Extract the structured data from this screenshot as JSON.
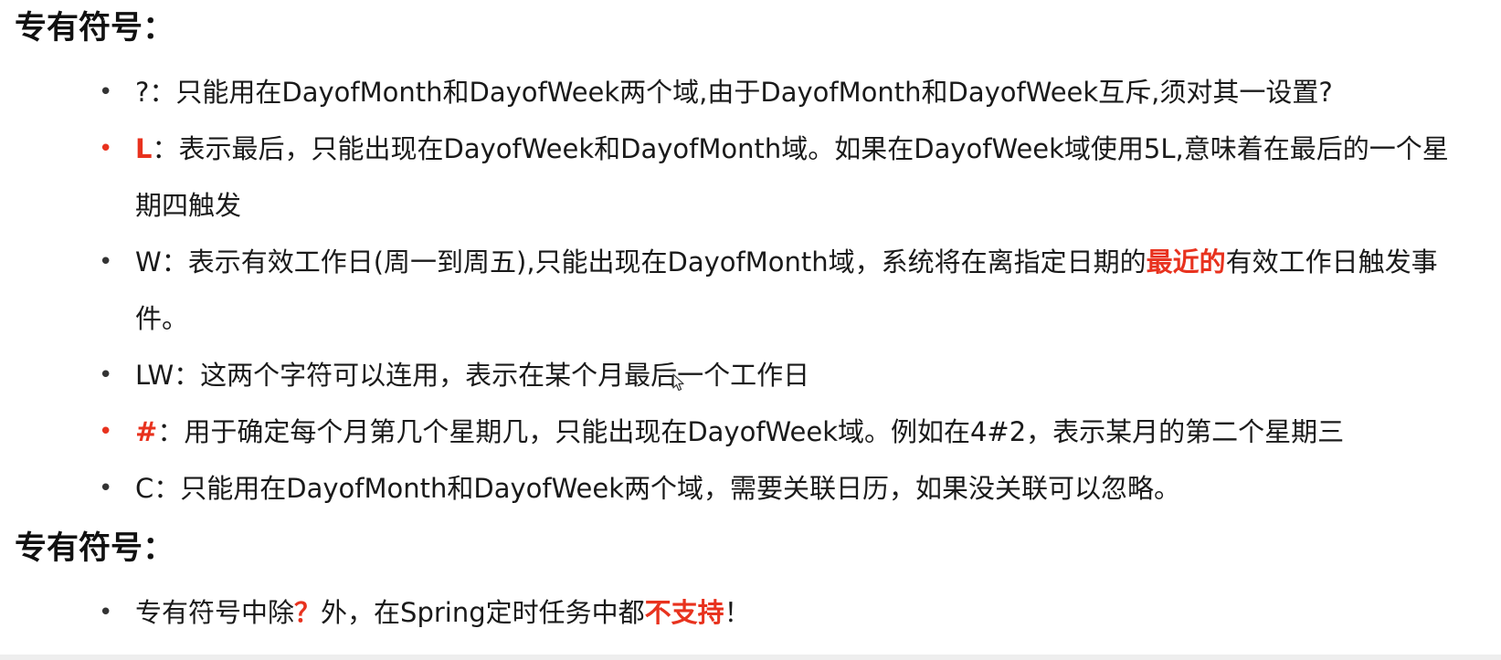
{
  "section1": {
    "heading": "专有符号："
  },
  "items": [
    {
      "key": "?",
      "text": "：只能用在DayofMonth和DayofWeek两个域,由于DayofMonth和DayofWeek互斥,须对其一设置?"
    },
    {
      "key": "L",
      "text": "：表示最后，只能出现在DayofWeek和DayofMonth域。如果在DayofWeek域使用5L,意味着在最后的一个星期四触发"
    },
    {
      "key": "W",
      "text_before": "：表示有效工作日(周一到周五),只能出现在DayofMonth域，系统将在离指定日期的",
      "highlight": "最近的",
      "text_after": "有效工作日触发事件。"
    },
    {
      "key": "LW",
      "text": "：这两个字符可以连用，表示在某个月最后一个工作日"
    },
    {
      "key": "#",
      "text": "：用于确定每个月第几个星期几，只能出现在DayofWeek域。例如在4#2，表示某月的第二个星期三"
    },
    {
      "key": "C",
      "text": "：只能用在DayofMonth和DayofWeek两个域，需要关联日历，如果没关联可以忽略。"
    }
  ],
  "section2": {
    "heading": "专有符号：",
    "item": {
      "text_before": "专有符号中除",
      "highlight_q": "？",
      "text_middle": "外，在Spring定时任务中都",
      "highlight": "不支持",
      "text_after": "！"
    }
  },
  "bullet_glyph": "•",
  "accent_color": "#e8321e"
}
